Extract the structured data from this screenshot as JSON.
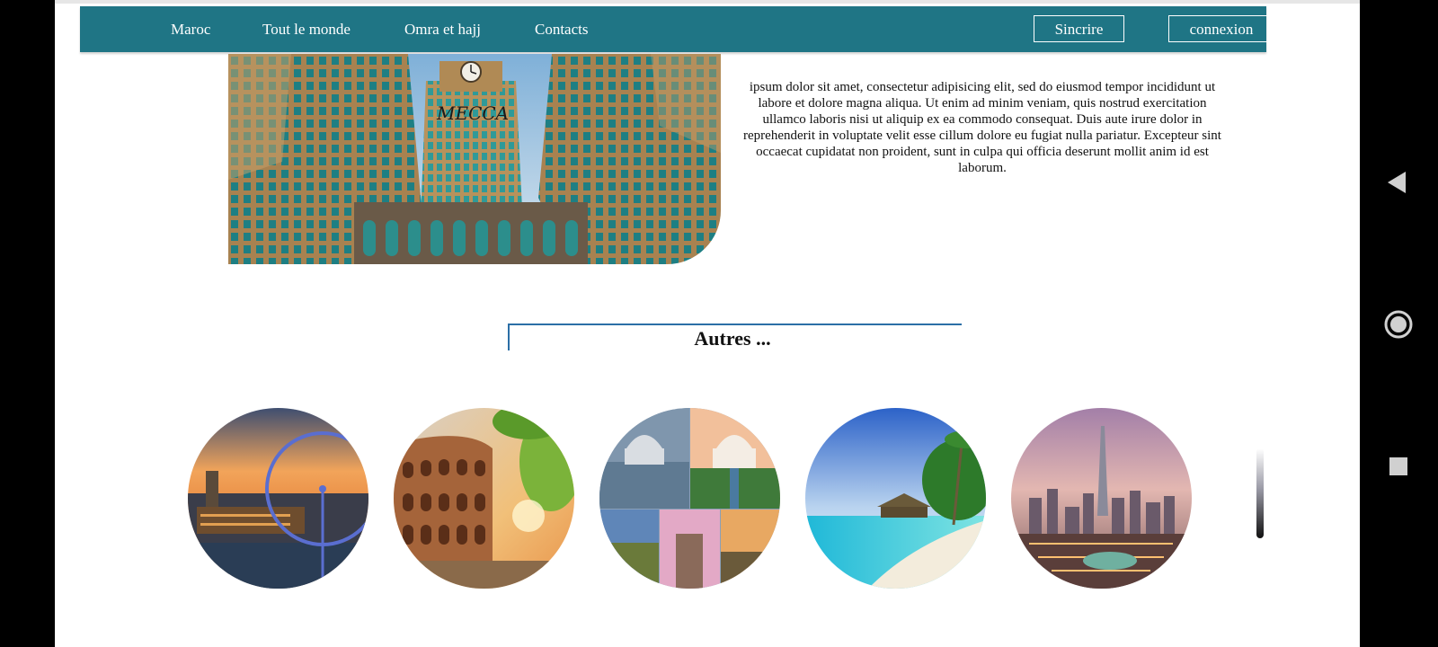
{
  "nav": {
    "links": [
      "Maroc",
      "Tout le monde",
      "Omra et hajj",
      "Contacts"
    ],
    "signup_label": "Sincrire",
    "login_label": "connexion"
  },
  "hero": {
    "image_caption": "MECCA",
    "paragraph": "ipsum dolor sit amet, consectetur adipisicing elit, sed do eiusmod tempor incididunt ut labore et dolore magna aliqua. Ut enim ad minim veniam, quis nostrud exercitation ullamco laboris nisi ut aliquip ex ea commodo consequat. Duis aute irure dolor in reprehenderit in voluptate velit esse cillum dolore eu fugiat nulla pariatur. Excepteur sint occaecat cupidatat non proident, sunt in culpa qui officia deserunt mollit anim id est laborum."
  },
  "section": {
    "title": "Autres ..."
  },
  "destinations": [
    {
      "icon": "london-image"
    },
    {
      "icon": "rome-colosseum-image"
    },
    {
      "icon": "india-collage-image"
    },
    {
      "icon": "tropical-beach-image"
    },
    {
      "icon": "dubai-skyline-image"
    }
  ],
  "colors": {
    "navbar": "#1f7585",
    "heading_border": "#2b6fa6",
    "page_background": "#ffffff",
    "frame_background": "#000000"
  },
  "system_nav": {
    "icons": [
      "back-triangle-icon",
      "home-circle-icon",
      "recents-square-icon"
    ]
  }
}
